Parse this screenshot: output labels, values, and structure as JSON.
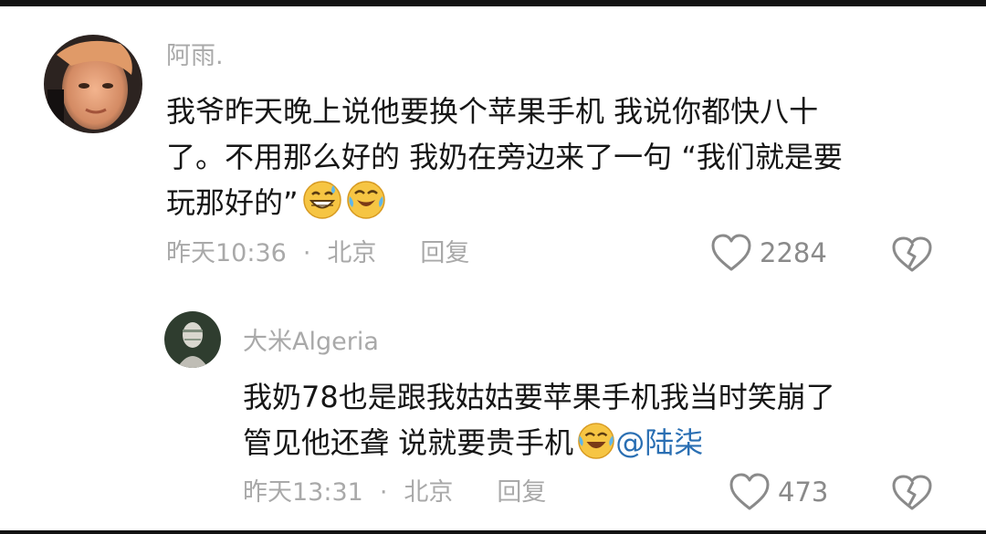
{
  "comments": [
    {
      "username": "阿雨.",
      "text_lines": [
        "我爷昨天晚上说他要换个苹果手机 我说你都快八十",
        "了。不用那么好的 我奶在旁边来了一句 “我们就是要",
        "玩那好的”"
      ],
      "emoji": [
        "grinning-sweat-emoji",
        "rolling-laugh-emoji"
      ],
      "time": "昨天10:36",
      "separator": "·",
      "location": "北京",
      "reply_label": "回复",
      "likes": "2284"
    },
    {
      "username": "大米Algeria",
      "text_lines": [
        "我奶78也是跟我姑姑要苹果手机我当时笑崩了",
        "管见他还聋 说就要贵手机"
      ],
      "emoji": [
        "tears-of-joy-emoji"
      ],
      "mention": "@陆柒",
      "time": "昨天13:31",
      "separator": "·",
      "location": "北京",
      "reply_label": "回复",
      "likes": "473"
    }
  ],
  "colors": {
    "username": "#a9a9a9",
    "text": "#161616",
    "meta": "#a9a9a9",
    "mention": "#2a6fb3"
  }
}
